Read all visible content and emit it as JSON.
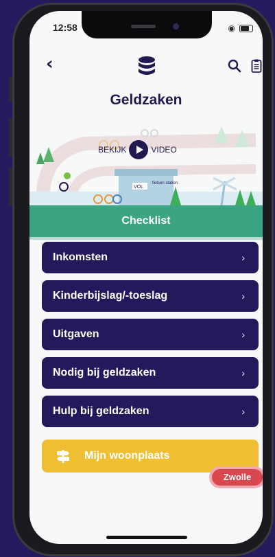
{
  "status": {
    "time": "12:58"
  },
  "header": {
    "title": "Geldzaken"
  },
  "banner": {
    "video_prefix": "BEKIJK",
    "video_suffix": "VIDEO",
    "sign_text": "VOL",
    "station_text": "fietsen station"
  },
  "checklist": {
    "title": "Checklist"
  },
  "items": [
    {
      "label": "Inkomsten"
    },
    {
      "label": "Kinderbijslag/-toeslag"
    },
    {
      "label": "Uitgaven"
    },
    {
      "label": "Nodig bij geldzaken"
    },
    {
      "label": "Hulp bij geldzaken"
    }
  ],
  "woonplaats": {
    "label": "Mijn woonplaats",
    "city": "Zwolle"
  },
  "colors": {
    "navy": "#231a5c",
    "green": "#3aa483",
    "yellow": "#f0be33",
    "red": "#d9474f",
    "background": "#241a5e"
  }
}
